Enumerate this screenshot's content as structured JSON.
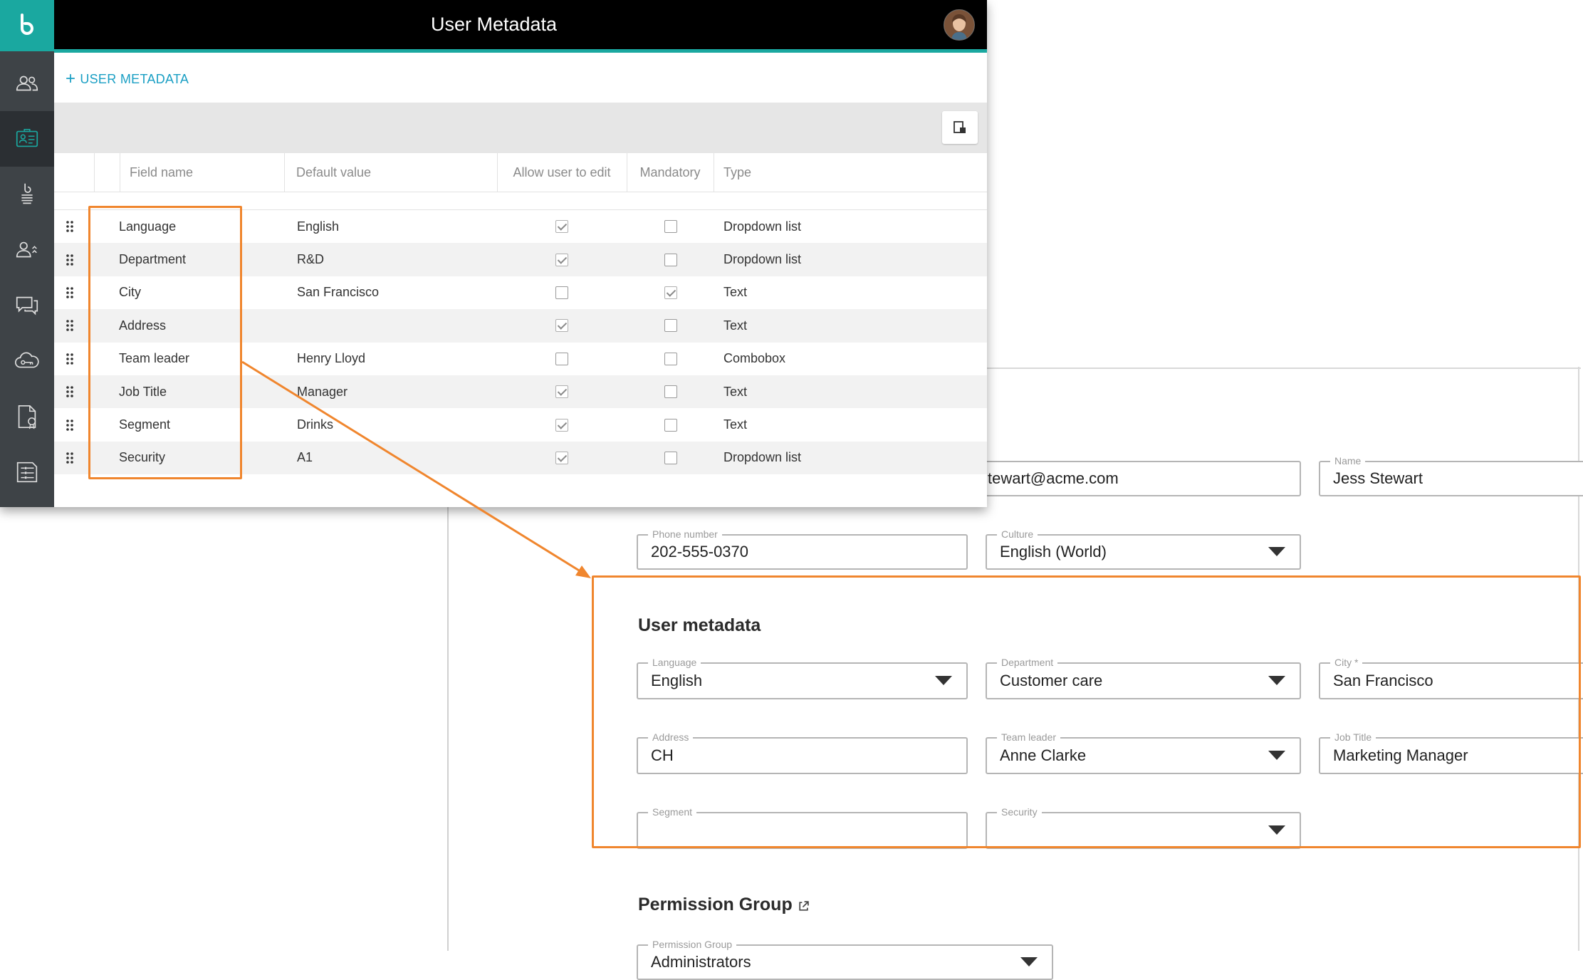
{
  "window": {
    "title": "User Metadata",
    "add_button_label": "USER METADATA",
    "columns": {
      "field_name": "Field name",
      "default_value": "Default value",
      "allow_edit": "Allow user to edit",
      "mandatory": "Mandatory",
      "type": "Type"
    },
    "rows": [
      {
        "field": "Language",
        "default": "English",
        "allow_edit": true,
        "mandatory": false,
        "type": "Dropdown list"
      },
      {
        "field": "Department",
        "default": "R&D",
        "allow_edit": true,
        "mandatory": false,
        "type": "Dropdown list"
      },
      {
        "field": "City",
        "default": "San Francisco",
        "allow_edit": false,
        "mandatory": true,
        "type": "Text"
      },
      {
        "field": "Address",
        "default": "",
        "allow_edit": true,
        "mandatory": false,
        "type": "Text"
      },
      {
        "field": "Team leader",
        "default": "Henry Lloyd",
        "allow_edit": false,
        "mandatory": false,
        "type": "Combobox"
      },
      {
        "field": "Job Title",
        "default": "Manager",
        "allow_edit": true,
        "mandatory": false,
        "type": "Text"
      },
      {
        "field": "Segment",
        "default": "Drinks",
        "allow_edit": true,
        "mandatory": false,
        "type": "Text"
      },
      {
        "field": "Security",
        "default": "A1",
        "allow_edit": true,
        "mandatory": false,
        "type": "Dropdown list"
      }
    ]
  },
  "sidebar": {
    "items": [
      "users-icon",
      "user-metadata-icon",
      "deploy-icon",
      "user-groups-icon",
      "chat-icon",
      "cloud-key-icon",
      "certificate-icon",
      "settings-list-icon"
    ]
  },
  "profile": {
    "email_value": "tewart@acme.com",
    "name_label": "Name",
    "name_value": "Jess Stewart",
    "phone_label": "Phone number",
    "phone_value": "202-555-0370",
    "culture_label": "Culture",
    "culture_value": "English (World)",
    "metadata_title": "User metadata",
    "language_label": "Language",
    "language_value": "English",
    "department_label": "Department",
    "department_value": "Customer care",
    "city_label": "City *",
    "city_value": "San Francisco",
    "address_label": "Address",
    "address_value": "CH",
    "team_leader_label": "Team leader",
    "team_leader_value": "Anne Clarke",
    "job_title_label": "Job Title",
    "job_title_value": "Marketing Manager",
    "segment_label": "Segment",
    "segment_value": "",
    "security_label": "Security",
    "security_value": "",
    "permission_title": "Permission Group",
    "permission_label": "Permission Group",
    "permission_value": "Administrators"
  },
  "colors": {
    "accent": "#1aa8a0",
    "highlight": "#f0862e",
    "link": "#1a9fc4"
  }
}
